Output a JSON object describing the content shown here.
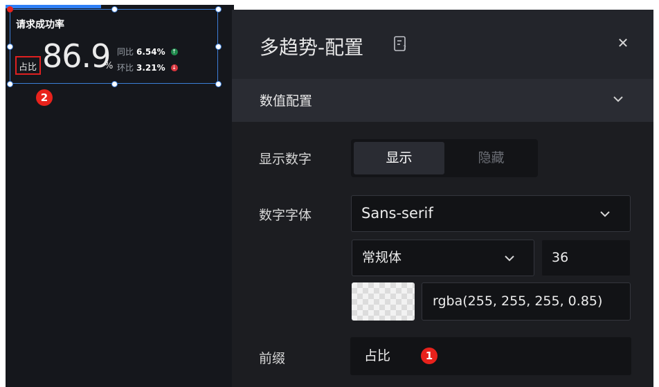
{
  "widget": {
    "title": "请求成功率",
    "prefix": "占比",
    "value": "86.9",
    "suffix": "%",
    "yoy_label": "同比",
    "yoy_value": "6.54%",
    "yoy_trend": "up",
    "mom_label": "环比",
    "mom_value": "3.21%",
    "mom_trend": "down",
    "up_color": "#1f8a4c",
    "down_color": "#d9363e"
  },
  "badges": {
    "one": "1",
    "two": "2"
  },
  "panel": {
    "title": "多趋势-配置",
    "section_title": "数值配置",
    "show_number": {
      "label": "显示数字",
      "options": [
        "显示",
        "隐藏"
      ],
      "selected": "显示"
    },
    "number_font": {
      "label": "数字字体",
      "family": "Sans-serif",
      "weight": "常规体",
      "size": "36",
      "color_value": "rgba(255, 255, 255, 0.85)"
    },
    "prefix": {
      "label": "前缀",
      "value": "占比"
    }
  },
  "colors": {
    "accent": "#2f7ff5",
    "selection_border": "#3c7fd9",
    "badge_red": "#e8221c"
  }
}
